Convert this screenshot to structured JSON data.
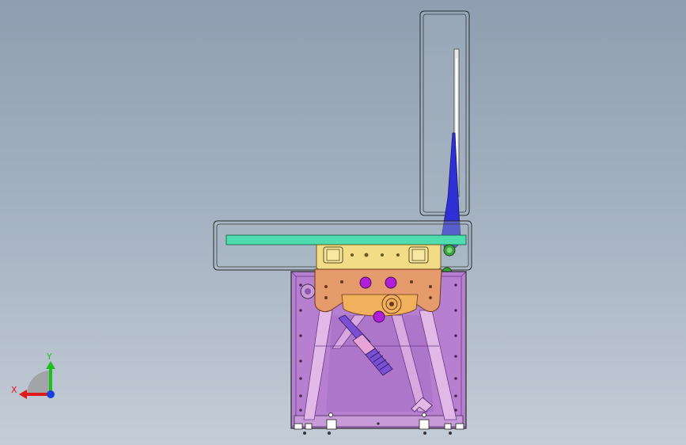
{
  "viewport": {
    "background_top": "#8f9eb0",
    "background_bottom": "#c4cdd7"
  },
  "model": {
    "colors": {
      "outline": "#2a2a2a",
      "housing_fill": "#b67fd0",
      "housing_dark": "#8d58ad",
      "frame_strut": "#e2b8e6",
      "bracket_yellow": "#f2dc86",
      "bracket_orange": "#e59b6c",
      "bearing_orange": "#f0b05c",
      "rail_green": "#4fdcae",
      "lever_blue": "#2f2fd6",
      "bolt_magenta": "#b01fd8",
      "screw_violet": "#7b4fd4",
      "screw_pink": "#e8a4d8",
      "sensor_green": "#3aa23a"
    }
  },
  "triad": {
    "x_label": "X",
    "y_label": "Y",
    "x_color": "#e0191a",
    "y_color": "#1fbf1f",
    "z_color": "#1a3fe0"
  }
}
